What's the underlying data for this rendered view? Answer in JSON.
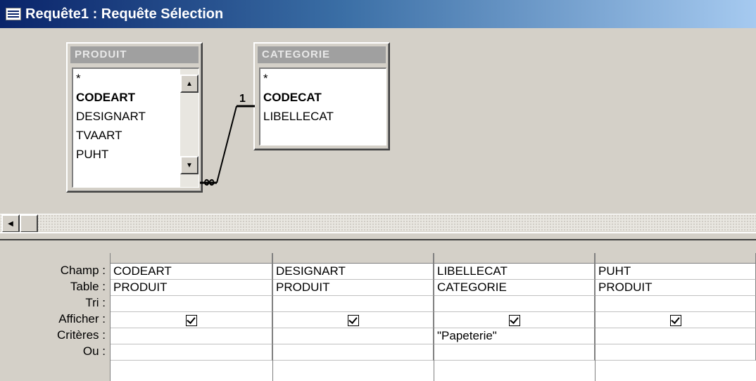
{
  "window": {
    "title": "Requête1 : Requête Sélection"
  },
  "tables": [
    {
      "name": "PRODUIT",
      "fields": [
        "*",
        "CODEART",
        "DESIGNART",
        "TVAART",
        "PUHT"
      ],
      "key_field": "CODEART"
    },
    {
      "name": "CATEGORIE",
      "fields": [
        "*",
        "CODECAT",
        "LIBELLECAT"
      ],
      "key_field": "CODECAT"
    }
  ],
  "relation": {
    "one_label": "1",
    "many_label": "∞"
  },
  "grid": {
    "row_labels": [
      "Champ :",
      "Table :",
      "Tri :",
      "Afficher :",
      "Critères :",
      "Ou :"
    ],
    "columns": [
      {
        "champ": "CODEART",
        "table": "PRODUIT",
        "tri": "",
        "afficher": true,
        "criteres": "",
        "ou": ""
      },
      {
        "champ": "DESIGNART",
        "table": "PRODUIT",
        "tri": "",
        "afficher": true,
        "criteres": "",
        "ou": ""
      },
      {
        "champ": "LIBELLECAT",
        "table": "CATEGORIE",
        "tri": "",
        "afficher": true,
        "criteres": "\"Papeterie\"",
        "ou": ""
      },
      {
        "champ": "PUHT",
        "table": "PRODUIT",
        "tri": "",
        "afficher": true,
        "criteres": "",
        "ou": ""
      }
    ]
  },
  "icons": {
    "window": "query-window-icon",
    "scroll_up": "arrow-up-icon",
    "scroll_down": "arrow-down-icon",
    "scroll_left": "arrow-left-icon"
  }
}
